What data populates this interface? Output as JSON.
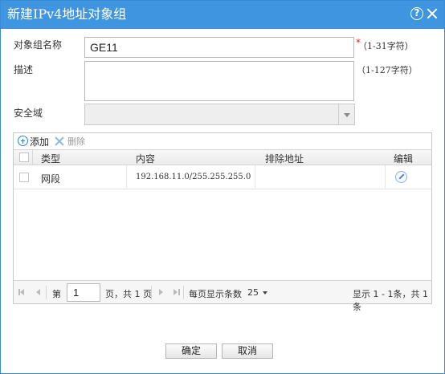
{
  "dialog": {
    "title": "新建IPv4地址对象组",
    "help_glyph": "?"
  },
  "form": {
    "name_label": "对象组名称",
    "name_value": "GE11",
    "required_mark": "*",
    "name_hint": "（1-31字符）",
    "desc_label": "描述",
    "desc_value": "",
    "desc_hint": "（1-127字符）",
    "zone_label": "安全域",
    "zone_value": ""
  },
  "toolbar": {
    "add_label": "添加",
    "delete_label": "删除"
  },
  "table": {
    "columns": [
      "类型",
      "内容",
      "排除地址",
      "编辑"
    ],
    "rows": [
      {
        "type": "网段",
        "content": "192.168.11.0/255.255.255.0",
        "exclude": ""
      }
    ]
  },
  "pager": {
    "page_prefix": "第",
    "page_value": "1",
    "page_suffix": "页，共 1 页",
    "per_page_label": "每页显示条数",
    "per_page_value": "25",
    "summary": "显示 1 - 1条，共 1 条"
  },
  "buttons": {
    "ok": "确定",
    "cancel": "取消"
  },
  "colors": {
    "titlebar": "#3f95e0",
    "required": "#e02020",
    "icon_blue": "#2f7fd0"
  }
}
